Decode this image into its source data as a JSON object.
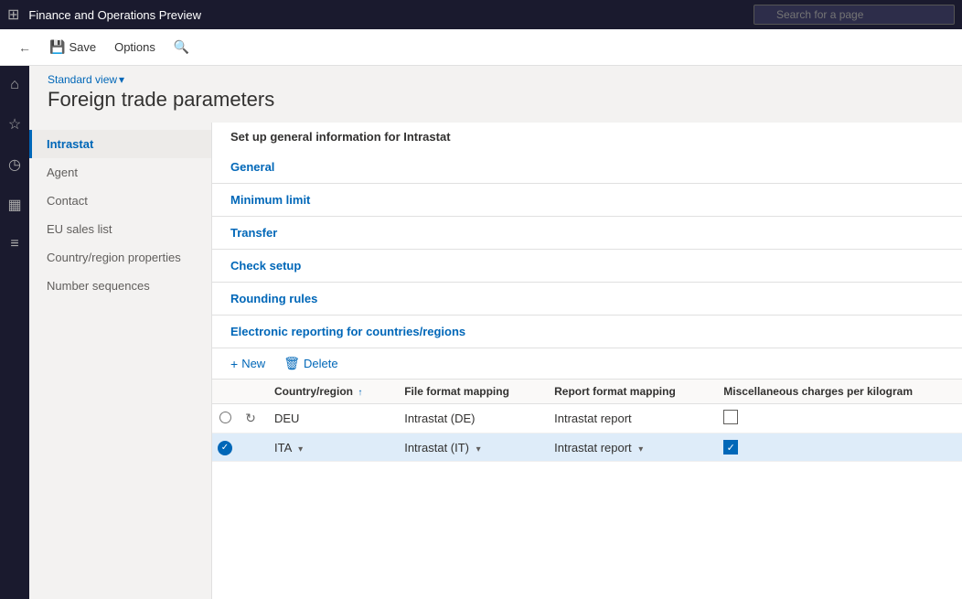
{
  "app": {
    "title": "Finance and Operations Preview",
    "search_placeholder": "Search for a page"
  },
  "toolbar": {
    "back_label": "",
    "save_label": "Save",
    "options_label": "Options",
    "search_icon": "🔍"
  },
  "breadcrumb": {
    "view_label": "Standard view",
    "chevron": "▾"
  },
  "page": {
    "title": "Foreign trade parameters"
  },
  "left_nav": {
    "items": [
      {
        "id": "intrastat",
        "label": "Intrastat",
        "active": true
      },
      {
        "id": "agent",
        "label": "Agent",
        "active": false
      },
      {
        "id": "contact",
        "label": "Contact",
        "active": false
      },
      {
        "id": "eu_sales_list",
        "label": "EU sales list",
        "active": false
      },
      {
        "id": "country_region",
        "label": "Country/region properties",
        "active": false
      },
      {
        "id": "number_sequences",
        "label": "Number sequences",
        "active": false
      }
    ]
  },
  "content": {
    "subtitle": "Set up general information for Intrastat",
    "sections": [
      {
        "id": "general",
        "label": "General"
      },
      {
        "id": "minimum_limit",
        "label": "Minimum limit"
      },
      {
        "id": "transfer",
        "label": "Transfer"
      },
      {
        "id": "check_setup",
        "label": "Check setup"
      },
      {
        "id": "rounding_rules",
        "label": "Rounding rules"
      }
    ],
    "electronic_section": {
      "title": "Electronic reporting for countries/regions",
      "new_label": "New",
      "delete_label": "Delete",
      "table": {
        "columns": [
          {
            "id": "country_region",
            "label": "Country/region",
            "sortable": true
          },
          {
            "id": "file_format",
            "label": "File format mapping"
          },
          {
            "id": "report_format",
            "label": "Report format mapping"
          },
          {
            "id": "misc_charges",
            "label": "Miscellaneous charges per kilogram"
          }
        ],
        "rows": [
          {
            "id": "deu",
            "selected": false,
            "country": "DEU",
            "file_format": "Intrastat (DE)",
            "report_format": "Intrastat report",
            "misc_checked": false
          },
          {
            "id": "ita",
            "selected": true,
            "country": "ITA",
            "file_format": "Intrastat (IT)",
            "report_format": "Intrastat report",
            "misc_checked": true
          }
        ]
      }
    }
  },
  "icons": {
    "grid": "⊞",
    "home": "⌂",
    "star": "☆",
    "clock": "○",
    "table": "▦",
    "list": "≡",
    "back": "←",
    "save_disk": "💾",
    "search": "🔍",
    "refresh": "↻",
    "plus": "+",
    "trash": "🗑",
    "check": "✓",
    "sort_up": "↑"
  }
}
